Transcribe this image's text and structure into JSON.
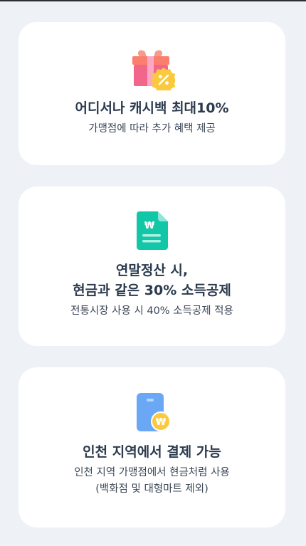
{
  "cards": [
    {
      "icon": "gift-percent-icon",
      "title": "어디서나 캐시백 최대10%",
      "description": "가맹점에 따라 추가 혜택 제공"
    },
    {
      "icon": "won-document-icon",
      "title": "연말정산 시,\n현금과 같은 30% 소득공제",
      "description": "전통시장 사용 시 40% 소득공제 적용"
    },
    {
      "icon": "won-card-icon",
      "title": "인천 지역에서 결제 가능",
      "description": "인천 지역 가맹점에서 현금처럼 사용\n(백화점 및 대형마트 제외)"
    }
  ],
  "colors": {
    "background": "#eef2f6",
    "card": "#ffffff",
    "title": "#2b3a4e",
    "gift_pink": "#f2668b",
    "badge_yellow": "#fbc93d",
    "doc_teal": "#12c7a8",
    "card_blue": "#6aa7f5"
  }
}
